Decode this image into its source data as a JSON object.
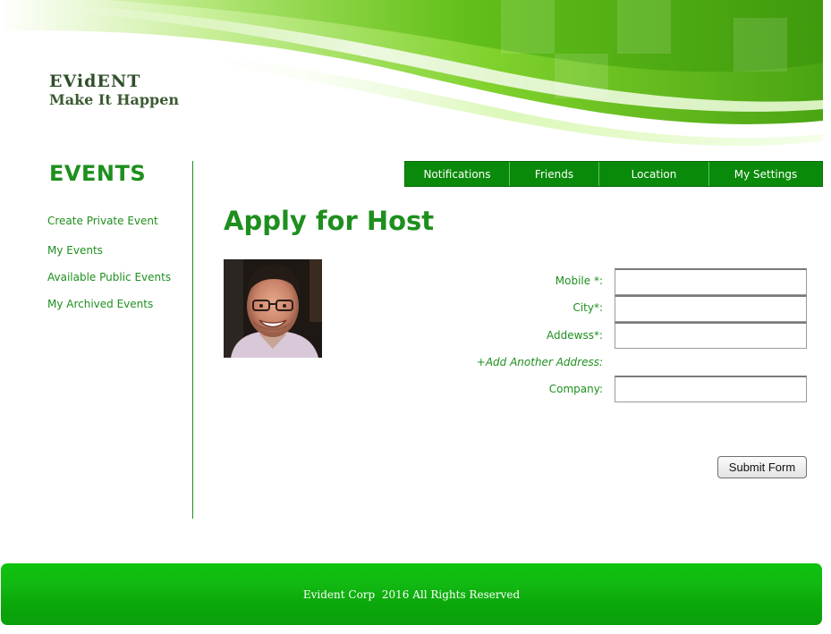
{
  "header": {
    "brand_name": "EVidENT",
    "tagline": "Make It Happen"
  },
  "sidebar": {
    "title": "EVENTS",
    "items": [
      {
        "label": "Create Private Event"
      },
      {
        "label": "My Events"
      },
      {
        "label": "Available Public Events"
      },
      {
        "label": "My Archived Events"
      }
    ]
  },
  "nav": {
    "items": [
      {
        "label": "Notifications"
      },
      {
        "label": "Friends"
      },
      {
        "label": "Location"
      },
      {
        "label": "My Settings"
      }
    ]
  },
  "main": {
    "title": "Apply for Host",
    "avatar_icon": "user-photo-icon",
    "form": {
      "mobile_label": "Mobile *:",
      "mobile_value": "",
      "city_label": "City*:",
      "city_value": "",
      "address_label": "Addewss*:",
      "address_value": "",
      "add_address_link": "+Add Another Address:",
      "company_label": "Company:",
      "company_value": "",
      "submit_label": "Submit Form"
    }
  },
  "footer": {
    "text": "Evident Corp  2016 All Rights Reserved"
  },
  "colors": {
    "brand_green": "#1e8f1e",
    "nav_green": "#0a8a0a",
    "footer_green": "#12b812",
    "header_text": "#2f4f2a"
  }
}
